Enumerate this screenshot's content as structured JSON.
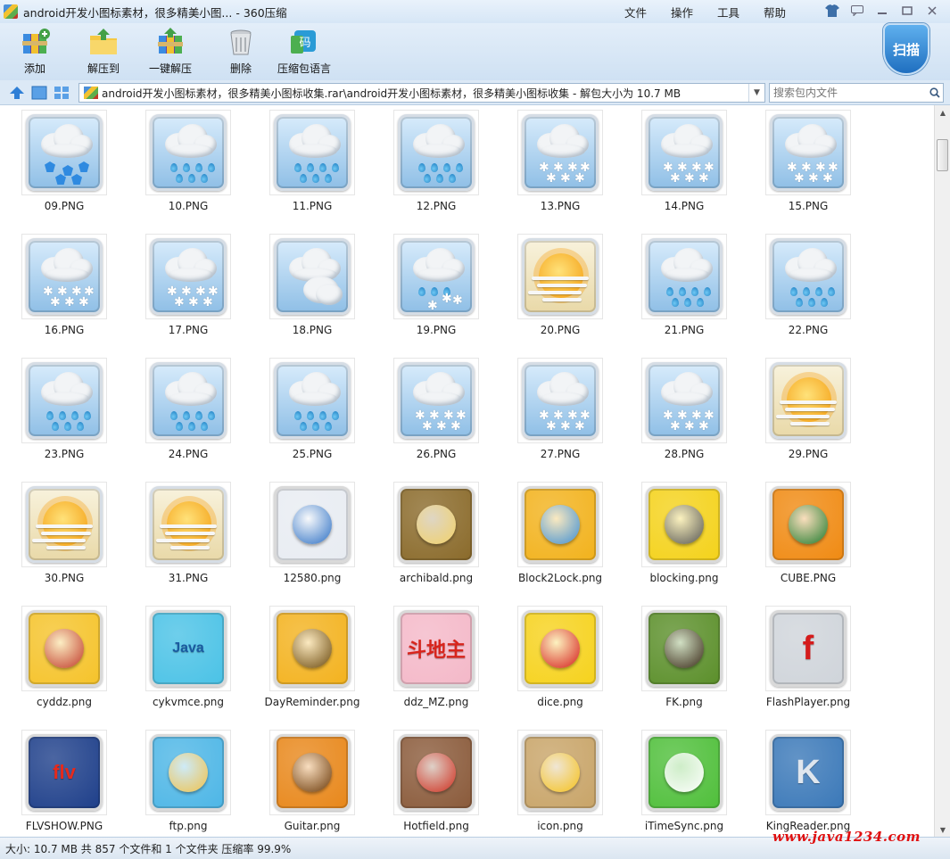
{
  "window": {
    "title": "android开发小图标素材，很多精美小图... - 360压缩",
    "menus": [
      "文件",
      "操作",
      "工具",
      "帮助"
    ]
  },
  "toolbar": {
    "add_label": "添加",
    "extract_to_label": "解压到",
    "one_click_extract_label": "一键解压",
    "delete_label": "删除",
    "archive_language_label": "压缩包语言",
    "scan_label": "扫描",
    "language_icon_text": "码"
  },
  "addressbar": {
    "path": "android开发小图标素材，很多精美小图标收集.rar\\android开发小图标素材，很多精美小图标收集 - 解包大小为 10.7 MB",
    "search_placeholder": "搜索包内文件"
  },
  "files": [
    {
      "name": "09.PNG",
      "kind": "weather-hail"
    },
    {
      "name": "10.PNG",
      "kind": "weather-rain"
    },
    {
      "name": "11.PNG",
      "kind": "weather-rain"
    },
    {
      "name": "12.PNG",
      "kind": "weather-rain"
    },
    {
      "name": "13.PNG",
      "kind": "weather-snow"
    },
    {
      "name": "14.PNG",
      "kind": "weather-snow"
    },
    {
      "name": "15.PNG",
      "kind": "weather-snow"
    },
    {
      "name": "16.PNG",
      "kind": "weather-snow"
    },
    {
      "name": "17.PNG",
      "kind": "weather-snow"
    },
    {
      "name": "18.PNG",
      "kind": "weather-cloudy"
    },
    {
      "name": "19.PNG",
      "kind": "weather-sleet"
    },
    {
      "name": "20.PNG",
      "kind": "weather-sun-haze"
    },
    {
      "name": "21.PNG",
      "kind": "weather-rain"
    },
    {
      "name": "22.PNG",
      "kind": "weather-rain"
    },
    {
      "name": "23.PNG",
      "kind": "weather-rain"
    },
    {
      "name": "24.PNG",
      "kind": "weather-rain"
    },
    {
      "name": "25.PNG",
      "kind": "weather-rain"
    },
    {
      "name": "26.PNG",
      "kind": "weather-snow"
    },
    {
      "name": "27.PNG",
      "kind": "weather-snow"
    },
    {
      "name": "28.PNG",
      "kind": "weather-snow"
    },
    {
      "name": "29.PNG",
      "kind": "weather-sun-haze"
    },
    {
      "name": "30.PNG",
      "kind": "weather-sun-haze"
    },
    {
      "name": "31.PNG",
      "kind": "weather-sun-haze"
    },
    {
      "name": "12580.png",
      "kind": "app",
      "bg": "#e8ecf2",
      "fg": "#2b6fc4"
    },
    {
      "name": "archibald.png",
      "kind": "app",
      "bg": "#8a6a2a",
      "fg": "#f3d36b"
    },
    {
      "name": "Block2Lock.png",
      "kind": "app",
      "bg": "#f2b21c",
      "fg": "#3d8fd6"
    },
    {
      "name": "blocking.png",
      "kind": "app",
      "bg": "#f4d21a",
      "fg": "#555555"
    },
    {
      "name": "CUBE.PNG",
      "kind": "app",
      "bg": "#f08a12",
      "fg": "#1d7b2f"
    },
    {
      "name": "cyddz.png",
      "kind": "app",
      "bg": "#f5c32a",
      "fg": "#c0392b"
    },
    {
      "name": "cykvmce.png",
      "kind": "app",
      "bg": "#4ac2e6",
      "fg": "#1a5aa0",
      "text": "Java"
    },
    {
      "name": "DayReminder.png",
      "kind": "app",
      "bg": "#f3b21e",
      "fg": "#6b4a10"
    },
    {
      "name": "ddz_MZ.png",
      "kind": "app",
      "bg": "#f4b8c8",
      "fg": "#d8241c",
      "text": "斗地主"
    },
    {
      "name": "dice.png",
      "kind": "app",
      "bg": "#f6d21c",
      "fg": "#d51b1b"
    },
    {
      "name": "FK.png",
      "kind": "app",
      "bg": "#5b8f2a",
      "fg": "#3b2a1a"
    },
    {
      "name": "FlashPlayer.png",
      "kind": "app",
      "bg": "#cfd4da",
      "fg": "#d51b1b",
      "text": "f"
    },
    {
      "name": "FLVSHOW.PNG",
      "kind": "app",
      "bg": "#1e3f8a",
      "fg": "#e62a1c",
      "text": "flv"
    },
    {
      "name": "ftp.png",
      "kind": "app",
      "bg": "#4db6e6",
      "fg": "#f2c24a"
    },
    {
      "name": "Guitar.png",
      "kind": "app",
      "bg": "#e8871a",
      "fg": "#6b3a0a"
    },
    {
      "name": "Hotfield.png",
      "kind": "app",
      "bg": "#8a5a3a",
      "fg": "#d03020"
    },
    {
      "name": "icon.png",
      "kind": "app",
      "bg": "#c8a468",
      "fg": "#f6c21a"
    },
    {
      "name": "iTimeSync.png",
      "kind": "app",
      "bg": "#4fbf3a",
      "fg": "#ffffff"
    },
    {
      "name": "KingReader.png",
      "kind": "app",
      "bg": "#3a78b8",
      "fg": "#dfe6ee",
      "text": "K"
    }
  ],
  "status": {
    "text": "大小: 10.7 MB 共 857 个文件和 1 个文件夹 压缩率 99.9%"
  },
  "watermark": "www.java1234.com"
}
